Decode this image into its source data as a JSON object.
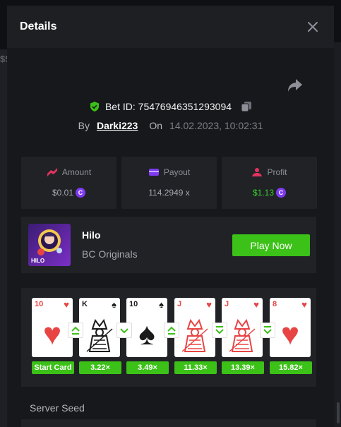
{
  "background": {
    "peek_text": "$5"
  },
  "modal": {
    "title": "Details"
  },
  "bet": {
    "id_text": "Bet ID: 75476946351293094",
    "by_label": "By",
    "username": "Darki223",
    "on_label": "On",
    "datetime": "14.02.2023, 10:02:31"
  },
  "stats": {
    "amount": {
      "label": "Amount",
      "value": "$0.01",
      "coin": "C"
    },
    "payout": {
      "label": "Payout",
      "value": "114.2949 x"
    },
    "profit": {
      "label": "Profit",
      "value": "$1.13",
      "coin": "C"
    }
  },
  "game": {
    "thumb_label": "HILO",
    "name": "Hilo",
    "provider": "BC Originals",
    "play_label": "Play Now"
  },
  "cards": [
    {
      "rank": "10",
      "suit": "♥",
      "color": "red",
      "face": false,
      "multiplier": "Start Card"
    },
    {
      "rank": "K",
      "suit": "♠",
      "color": "black",
      "face": true,
      "multiplier": "3.22×"
    },
    {
      "rank": "10",
      "suit": "♠",
      "color": "black",
      "face": false,
      "multiplier": "3.49×"
    },
    {
      "rank": "J",
      "suit": "♥",
      "color": "red",
      "face": true,
      "multiplier": "11.33×"
    },
    {
      "rank": "J",
      "suit": "♥",
      "color": "red",
      "face": true,
      "multiplier": "13.39×"
    },
    {
      "rank": "8",
      "suit": "♥",
      "color": "red",
      "face": false,
      "multiplier": "15.82×"
    }
  ],
  "arrows": [
    {
      "direction": "higher-or-same",
      "icon": "arrow-up-outline-icon"
    },
    {
      "direction": "lower",
      "icon": "arrow-down-icon"
    },
    {
      "direction": "higher-or-same",
      "icon": "arrow-up-outline-icon"
    },
    {
      "direction": "lower-or-same",
      "icon": "arrow-down-outline-icon"
    },
    {
      "direction": "lower-or-same",
      "icon": "arrow-down-outline-icon"
    }
  ],
  "server_seed": {
    "label": "Server Seed"
  },
  "colors": {
    "accent_green": "#3bc117",
    "modal_bg": "#17181b",
    "panel_bg": "#202226",
    "coin_purple": "#7d3af0",
    "card_red": "#e84444"
  }
}
